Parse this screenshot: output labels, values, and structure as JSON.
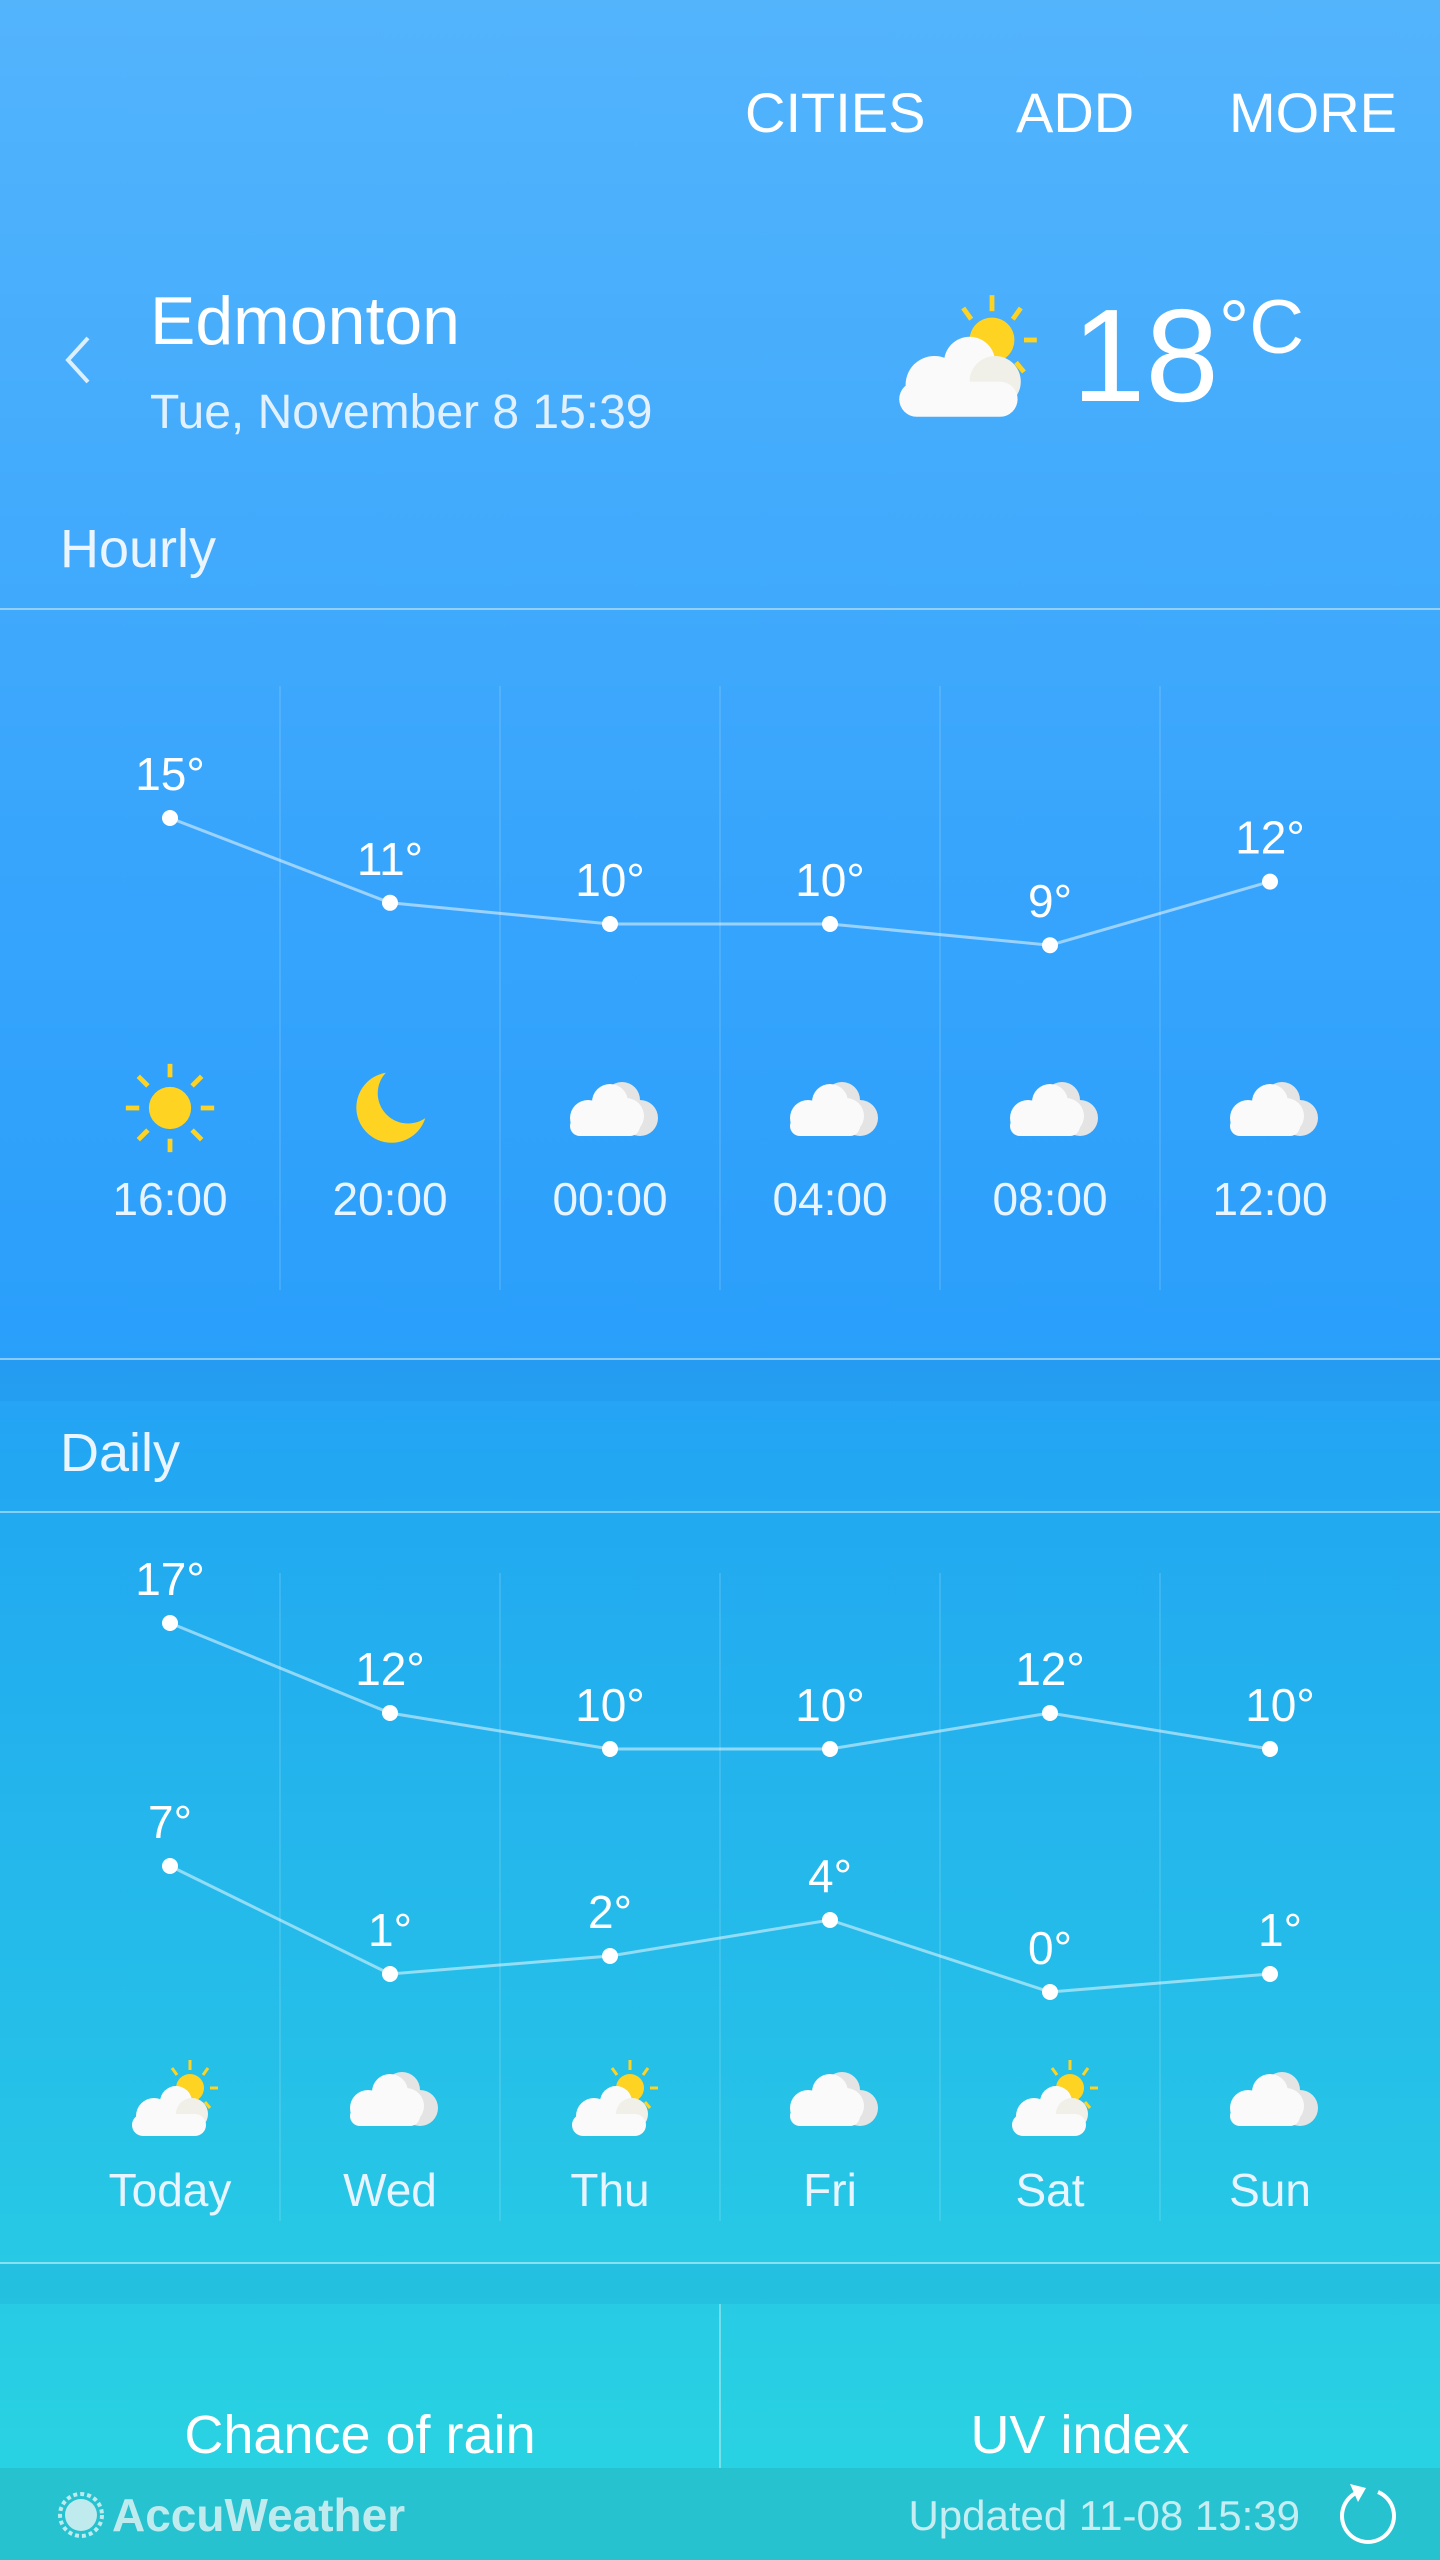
{
  "header": {
    "menu": [
      "CITIES",
      "ADD",
      "MORE"
    ],
    "city": "Edmonton",
    "date": "Tue, November 8 15:39",
    "current_temp": "18",
    "unit": "°C",
    "unit_degree": "°",
    "unit_letter": "C",
    "current_icon": "partly-cloudy-icon"
  },
  "hourly": {
    "title": "Hourly",
    "items": [
      {
        "time": "16:00",
        "temp": 15,
        "label": "15°",
        "icon": "sun"
      },
      {
        "time": "20:00",
        "temp": 11,
        "label": "11°",
        "icon": "moon"
      },
      {
        "time": "00:00",
        "temp": 10,
        "label": "10°",
        "icon": "cloud"
      },
      {
        "time": "04:00",
        "temp": 10,
        "label": "10°",
        "icon": "cloud"
      },
      {
        "time": "08:00",
        "temp": 9,
        "label": "9°",
        "icon": "cloud"
      },
      {
        "time": "12:00",
        "temp": 12,
        "label": "12°",
        "icon": "cloud"
      }
    ]
  },
  "daily": {
    "title": "Daily",
    "items": [
      {
        "day": "Today",
        "high": 17,
        "low": 7,
        "high_label": "17°",
        "low_label": "7°",
        "icon": "partly"
      },
      {
        "day": "Wed",
        "high": 12,
        "low": 1,
        "high_label": "12°",
        "low_label": "1°",
        "icon": "cloud"
      },
      {
        "day": "Thu",
        "high": 10,
        "low": 2,
        "high_label": "10°",
        "low_label": "2°",
        "icon": "partly"
      },
      {
        "day": "Fri",
        "high": 10,
        "low": 4,
        "high_label": "10°",
        "low_label": "4°",
        "icon": "cloud"
      },
      {
        "day": "Sat",
        "high": 12,
        "low": 0,
        "high_label": "12°",
        "low_label": "0°",
        "icon": "partly"
      },
      {
        "day": "Sun",
        "high": 10,
        "low": 1,
        "high_label": "10°",
        "low_label": "1°",
        "icon": "cloud"
      }
    ]
  },
  "cards": {
    "rain": "Chance of rain",
    "uv": "UV index"
  },
  "footer": {
    "brand": "AccuWeather",
    "updated": "Updated 11-08  15:39"
  },
  "colors": {
    "sun": "#ffd321",
    "cloud": "#fafafa",
    "footer": "#26c2cf"
  }
}
